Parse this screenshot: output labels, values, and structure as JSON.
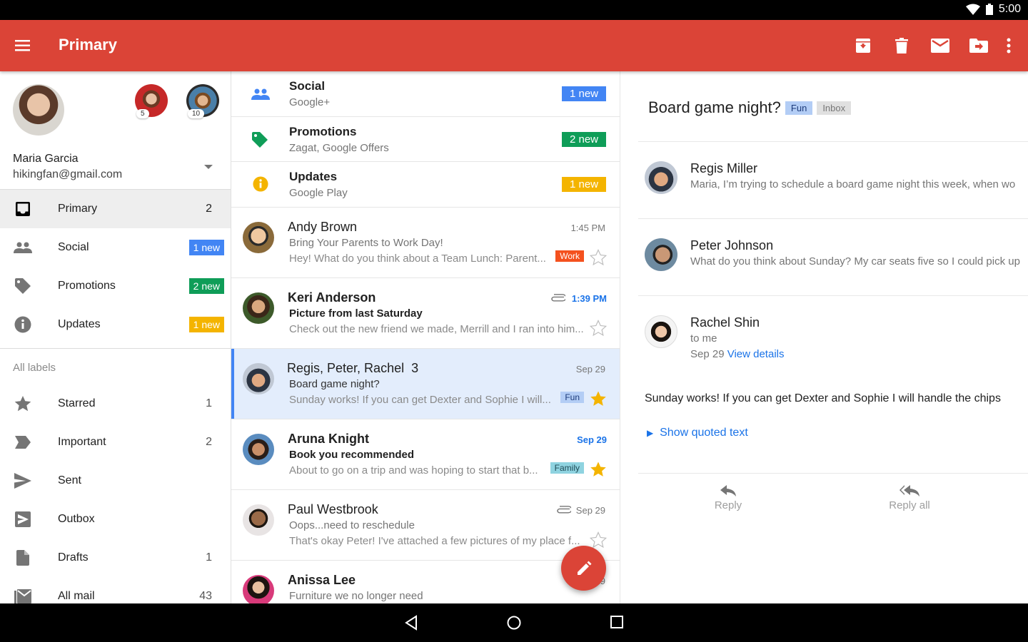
{
  "status_bar": {
    "time": "5:00",
    "icons": [
      "wifi-icon",
      "battery-icon"
    ]
  },
  "app_bar": {
    "title": "Primary",
    "actions": [
      "archive",
      "delete",
      "mark-unread",
      "move-to",
      "more-options"
    ]
  },
  "drawer": {
    "account": {
      "name": "Maria Garcia",
      "email": "hikingfan@gmail.com",
      "other_accounts": [
        {
          "count": "5"
        },
        {
          "count": "10"
        }
      ]
    },
    "primary_items": [
      {
        "label": "Primary",
        "count": "2",
        "icon": "inbox-icon",
        "active": true
      },
      {
        "label": "Social",
        "badge": "1 new",
        "badge_color": "#4285f4",
        "icon": "people-icon"
      },
      {
        "label": "Promotions",
        "badge": "2 new",
        "badge_color": "#0f9d58",
        "icon": "tag-icon"
      },
      {
        "label": "Updates",
        "badge": "1 new",
        "badge_color": "#f4b400",
        "icon": "info-icon"
      }
    ],
    "all_labels_heading": "All labels",
    "labels": [
      {
        "label": "Starred",
        "count": "1",
        "icon": "star-icon"
      },
      {
        "label": "Important",
        "count": "2",
        "icon": "important-icon"
      },
      {
        "label": "Sent",
        "count": "",
        "icon": "send-icon"
      },
      {
        "label": "Outbox",
        "count": "",
        "icon": "outbox-icon"
      },
      {
        "label": "Drafts",
        "count": "1",
        "icon": "draft-icon"
      },
      {
        "label": "All mail",
        "count": "43",
        "icon": "all-mail-icon"
      }
    ]
  },
  "list": {
    "categories": [
      {
        "title": "Social",
        "subtitle": "Google+",
        "badge": "1 new",
        "color": "#4285f4"
      },
      {
        "title": "Promotions",
        "subtitle": "Zagat, Google Offers",
        "badge": "2 new",
        "color": "#0f9d58"
      },
      {
        "title": "Updates",
        "subtitle": "Google Play",
        "badge": "1 new",
        "color": "#f4b400"
      }
    ],
    "emails": [
      {
        "from": "Andy Brown",
        "subject": "Bring Your Parents to Work Day!",
        "snippet": "Hey! What do you think about a Team Lunch: Parent...",
        "time": "1:45 PM",
        "label": "Work",
        "unread": false,
        "starred": false,
        "attachment": false
      },
      {
        "from": "Keri Anderson",
        "subject": "Picture from last Saturday",
        "snippet": "Check out the new friend we made, Merrill and I ran into him...",
        "time": "1:39 PM",
        "label": "",
        "unread": true,
        "starred": false,
        "attachment": true
      },
      {
        "from": "Regis, Peter, Rachel",
        "thread_count": "3",
        "subject": "Board game night?",
        "snippet": "Sunday works! If you can get Dexter and Sophie I will...",
        "time": "Sep 29",
        "label": "Fun",
        "unread": false,
        "starred": true,
        "attachment": false,
        "selected": true
      },
      {
        "from": "Aruna Knight",
        "subject": "Book you recommended",
        "snippet": "About to go on a trip and was hoping to start that b...",
        "time": "Sep 29",
        "label": "Family",
        "unread": true,
        "starred": true,
        "attachment": false
      },
      {
        "from": "Paul Westbrook",
        "subject": "Oops...need to reschedule",
        "snippet": "That's okay Peter! I've attached a few pictures of my place f...",
        "time": "Sep 29",
        "label": "",
        "unread": false,
        "starred": false,
        "attachment": true
      },
      {
        "from": "Anissa Lee",
        "subject": "Furniture we no longer need",
        "snippet": "",
        "time": "Sep 29",
        "label": "",
        "unread": true,
        "starred": false,
        "attachment": false
      }
    ]
  },
  "detail": {
    "subject": "Board game night?",
    "labels": [
      "Fun",
      "Inbox"
    ],
    "messages": [
      {
        "sender": "Regis Miller",
        "preview": "Maria, I’m trying to schedule a board game night this week, when wo"
      },
      {
        "sender": "Peter Johnson",
        "preview": "What do you think about Sunday? My car seats five so I could pick up"
      },
      {
        "sender": "Rachel Shin",
        "to": "to me",
        "date": "Sep 29",
        "view_details": "View details"
      }
    ],
    "body": "Sunday works! If you can get Dexter and Sophie I will handle the chips",
    "show_quoted": "Show quoted text",
    "reply": "Reply",
    "reply_all": "Reply all"
  },
  "fab": {
    "icon": "compose-pencil-icon"
  },
  "nav_bar": [
    "back",
    "home",
    "recents"
  ]
}
